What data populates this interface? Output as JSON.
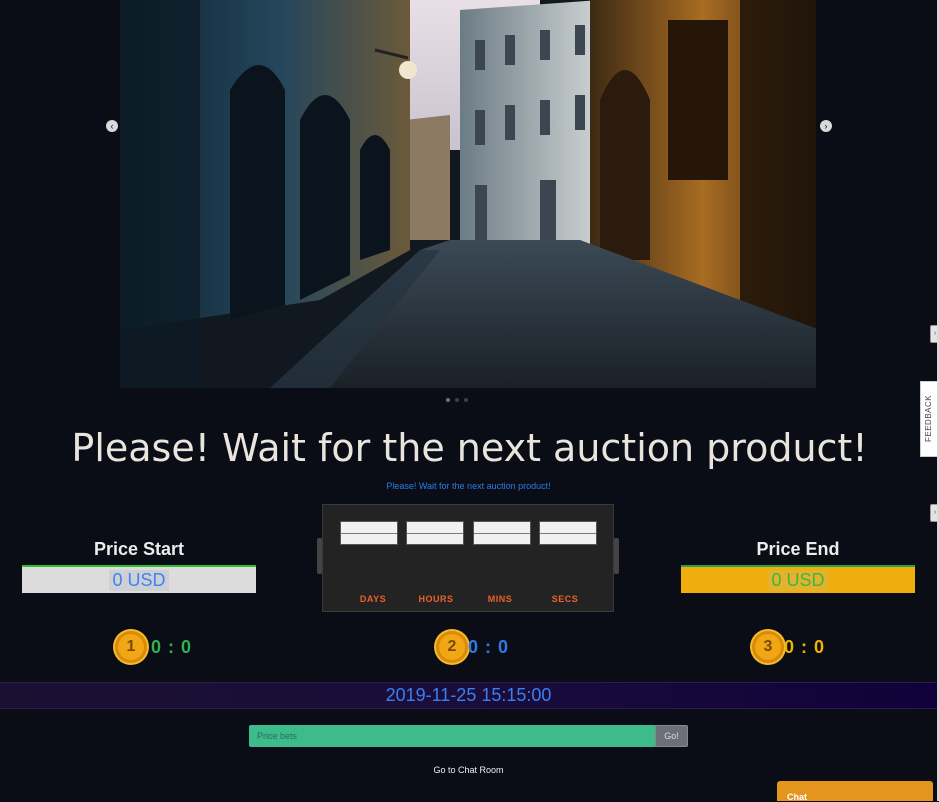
{
  "heading": "Please! Wait for the next auction product!",
  "subheading": "Please! Wait for the next auction product!",
  "carousel": {
    "prev_icon": "‹",
    "next_icon": "›",
    "slide_count": 3,
    "active_slide": 1
  },
  "feedback_label": "FEEDBACK",
  "price_start": {
    "title": "Price Start",
    "value": "0 USD"
  },
  "price_end": {
    "title": "Price End",
    "value": "0 USD"
  },
  "countdown": {
    "labels": [
      "DAYS",
      "HOURS",
      "MINS",
      "SECS"
    ]
  },
  "podium": [
    {
      "rank": "1",
      "score": "0 : 0",
      "color": "#2fb34c"
    },
    {
      "rank": "2",
      "score": "0 : 0",
      "color": "#2c7be5"
    },
    {
      "rank": "3",
      "score": "0 : 0",
      "color": "#f0b400"
    }
  ],
  "timestamp": "2019-11-25 15:15:00",
  "bet": {
    "placeholder": "Price bets",
    "button_label": "Go!"
  },
  "chat_room_link": "Go to Chat Room",
  "chat_widget_label": "Chat",
  "colors": {
    "background": "#0a0d16",
    "accent_blue": "#2c7be5",
    "price_end_bg": "#f0ae0e",
    "bet_bar": "#3dbb8c",
    "chat_widget": "#e3951d",
    "countdown_label": "#e8622a"
  }
}
